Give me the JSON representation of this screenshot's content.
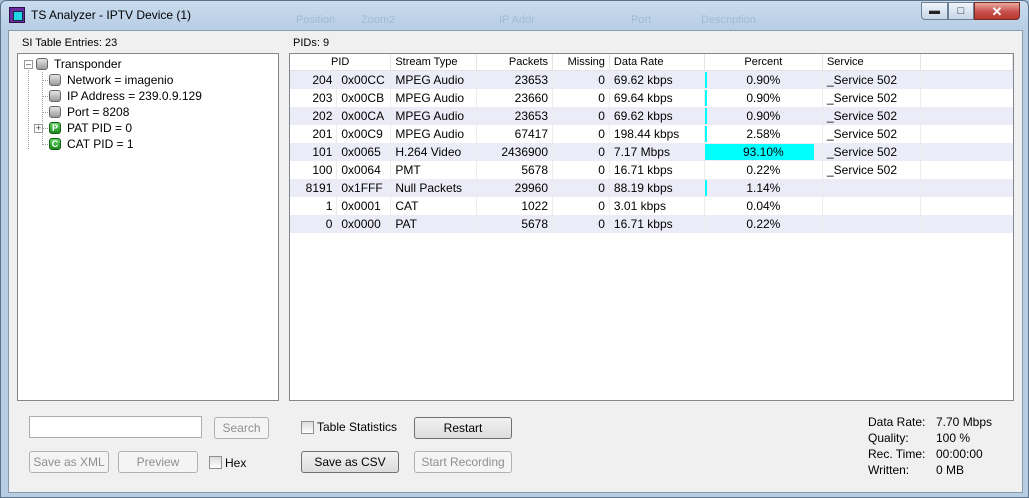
{
  "window": {
    "title": "TS Analyzer - IPTV Device (1)"
  },
  "ghost_header": [
    "Position",
    "Zoom2",
    "IP Addr",
    "Port",
    "Description"
  ],
  "left": {
    "header": "SI Table Entries: 23",
    "tree": {
      "root": "Transponder",
      "children": [
        {
          "label": "Network = imagenio",
          "icon": "gray-node-icon"
        },
        {
          "label": "IP Address = 239.0.9.129",
          "icon": "gray-node-icon"
        },
        {
          "label": "Port = 8208",
          "icon": "gray-node-icon"
        },
        {
          "label": "PAT PID = 0",
          "icon": "green-p-icon",
          "letter": "P",
          "expandable": true
        },
        {
          "label": "CAT PID = 1",
          "icon": "green-c-icon",
          "letter": "C"
        }
      ]
    },
    "search": {
      "value": "",
      "button": "Search"
    },
    "buttons": {
      "save_xml": "Save as XML",
      "preview": "Preview",
      "hex": "Hex"
    }
  },
  "right": {
    "header": "PIDs: 9",
    "columns": [
      "PID",
      "Stream Type",
      "Packets",
      "Missing",
      "Data Rate",
      "Percent",
      "Service"
    ],
    "rows": [
      {
        "pid": "204",
        "hex": "0x00CC",
        "type": "MPEG Audio",
        "packets": "23653",
        "missing": "0",
        "rate": "69.62 kbps",
        "percent": "0.90%",
        "pct_value": 0.9,
        "service": "_Service 502"
      },
      {
        "pid": "203",
        "hex": "0x00CB",
        "type": "MPEG Audio",
        "packets": "23660",
        "missing": "0",
        "rate": "69.64 kbps",
        "percent": "0.90%",
        "pct_value": 0.9,
        "service": "_Service 502"
      },
      {
        "pid": "202",
        "hex": "0x00CA",
        "type": "MPEG Audio",
        "packets": "23653",
        "missing": "0",
        "rate": "69.62 kbps",
        "percent": "0.90%",
        "pct_value": 0.9,
        "service": "_Service 502"
      },
      {
        "pid": "201",
        "hex": "0x00C9",
        "type": "MPEG Audio",
        "packets": "67417",
        "missing": "0",
        "rate": "198.44 kbps",
        "percent": "2.58%",
        "pct_value": 2.58,
        "service": "_Service 502"
      },
      {
        "pid": "101",
        "hex": "0x0065",
        "type": "H.264 Video",
        "packets": "2436900",
        "missing": "0",
        "rate": "7.17 Mbps",
        "percent": "93.10%",
        "pct_value": 93.1,
        "service": "_Service 502"
      },
      {
        "pid": "100",
        "hex": "0x0064",
        "type": "PMT",
        "packets": "5678",
        "missing": "0",
        "rate": "16.71 kbps",
        "percent": "0.22%",
        "pct_value": 0.22,
        "service": "_Service 502"
      },
      {
        "pid": "8191",
        "hex": "0x1FFF",
        "type": "Null Packets",
        "packets": "29960",
        "missing": "0",
        "rate": "88.19 kbps",
        "percent": "1.14%",
        "pct_value": 1.14,
        "service": ""
      },
      {
        "pid": "1",
        "hex": "0x0001",
        "type": "CAT",
        "packets": "1022",
        "missing": "0",
        "rate": "3.01 kbps",
        "percent": "0.04%",
        "pct_value": 0.04,
        "service": ""
      },
      {
        "pid": "0",
        "hex": "0x0000",
        "type": "PAT",
        "packets": "5678",
        "missing": "0",
        "rate": "16.71 kbps",
        "percent": "0.22%",
        "pct_value": 0.22,
        "service": ""
      }
    ],
    "bar_color": "#00ffff",
    "controls": {
      "table_statistics": "Table Statistics",
      "restart": "Restart",
      "save_csv": "Save as CSV",
      "start_recording": "Start Recording"
    },
    "stats": [
      {
        "label": "Data Rate:",
        "value": "7.70 Mbps"
      },
      {
        "label": "Quality:",
        "value": "100 %"
      },
      {
        "label": "Rec. Time:",
        "value": "00:00:00"
      },
      {
        "label": "Written:",
        "value": "0 MB"
      }
    ]
  }
}
